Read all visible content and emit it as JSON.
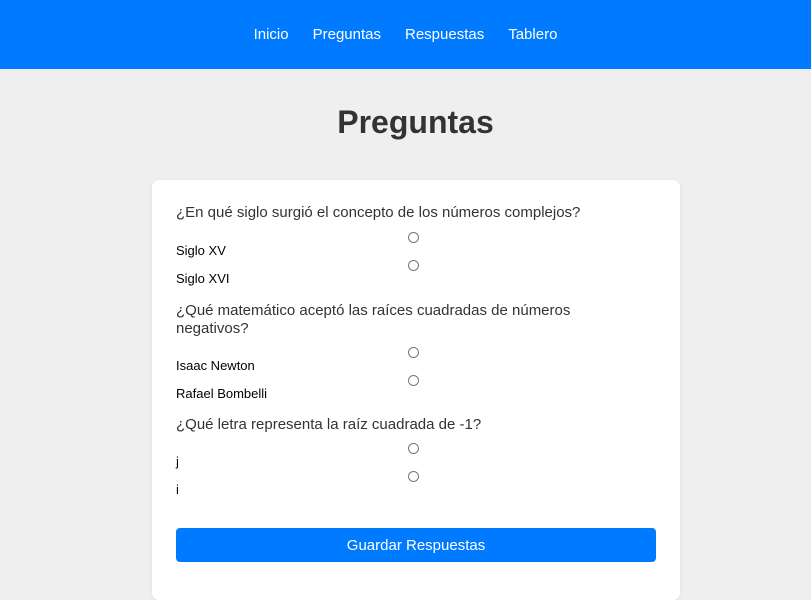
{
  "nav": {
    "items": [
      "Inicio",
      "Preguntas",
      "Respuestas",
      "Tablero"
    ]
  },
  "page": {
    "title": "Preguntas"
  },
  "questions": [
    {
      "text": "¿En qué siglo surgió el concepto de los números complejos?",
      "options": [
        "Siglo XV",
        "Siglo XVI"
      ]
    },
    {
      "text": "¿Qué matemático aceptó las raíces cuadradas de números negativos?",
      "options": [
        "Isaac Newton",
        "Rafael Bombelli"
      ]
    },
    {
      "text": "¿Qué letra representa la raíz cuadrada de -1?",
      "options": [
        "j",
        "i"
      ]
    }
  ],
  "form": {
    "submit_label": "Guardar Respuestas"
  },
  "colors": {
    "primary": "#007bff",
    "background": "#efefef",
    "card": "#ffffff"
  }
}
